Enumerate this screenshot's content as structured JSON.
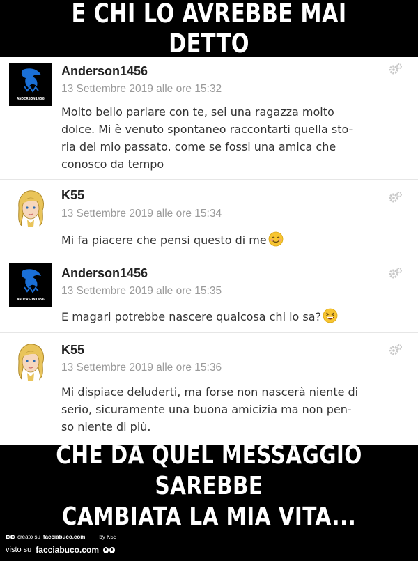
{
  "top_caption": "E CHI LO AVREBBE MAI DETTO",
  "bottom_caption_line1": "CHE DA QUEL MESSAGGIO SAREBBE",
  "bottom_caption_line2": "CAMBIATA LA MIA VITA...",
  "posts": [
    {
      "author": "Anderson1456",
      "avatar_text": "ANDERSON1456",
      "date": "13 Settembre 2019 alle ore 15:32",
      "lines": [
        "Molto bello parlare con te, sei una ragazza molto",
        "dolce. Mi è venuto spontaneo raccontarti quella sto-",
        "ria del mio passato. come se fossi una amica che",
        "conosco da tempo"
      ]
    },
    {
      "author": "K55",
      "date": "13 Settembre 2019 alle ore 15:34",
      "lines": [
        "Mi fa piacere che pensi questo di me"
      ],
      "emoji": "smiling-face-icon"
    },
    {
      "author": "Anderson1456",
      "avatar_text": "ANDERSON1456",
      "date": "13 Settembre 2019 alle ore 15:35",
      "lines": [
        "E magari potrebbe nascere qualcosa chi lo sa?"
      ],
      "emoji": "grinning-squint-face-icon"
    },
    {
      "author": "K55",
      "date": "13 Settembre 2019 alle ore 15:36",
      "lines": [
        "Mi dispiace deluderti, ma forse non nascerà niente di",
        "serio, sicuramente una buona amicizia ma non pen-",
        "so niente di più."
      ]
    }
  ],
  "footer": {
    "created_on": "creato su",
    "created_site": "facciabuco.com",
    "by": "by K55",
    "seen_on": "visto su",
    "seen_site": "facciabuco.com"
  },
  "colors": {
    "background": "#000000",
    "feed": "#ffffff",
    "eagle_blue": "#1a6fd6",
    "date_gray": "#9a9a9a"
  }
}
